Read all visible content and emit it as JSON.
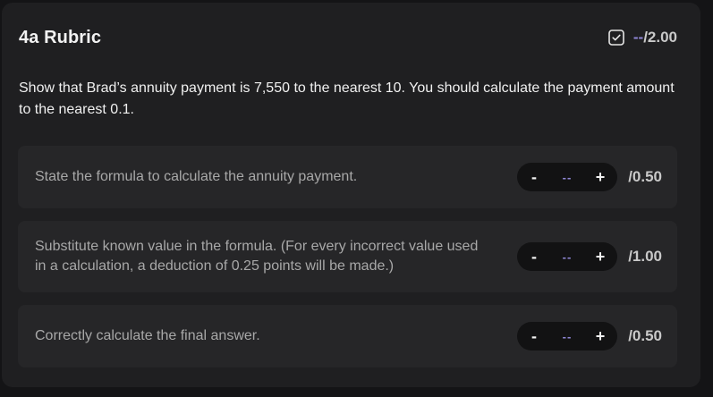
{
  "rubric": {
    "title": "4a Rubric",
    "total_score": "--",
    "total_max": "/2.00",
    "question": "Show that Brad’s annuity payment is 7,550 to the nearest 10. You should calculate the payment amount to the nearest 0.1."
  },
  "criteria": [
    {
      "text": "State the formula to calculate the annuity payment.",
      "decrement_label": "-",
      "score": "--",
      "increment_label": "+",
      "max": "/0.50"
    },
    {
      "text": "Substitute known value in the formula. (For every incorrect value used in a calculation, a deduction of 0.25 points will be made.)",
      "decrement_label": "-",
      "score": "--",
      "increment_label": "+",
      "max": "/1.00"
    },
    {
      "text": "Correctly calculate the final answer.",
      "decrement_label": "-",
      "score": "--",
      "increment_label": "+",
      "max": "/0.50"
    }
  ],
  "colors": {
    "accent": "#8f86d6",
    "panel": "#1f1f21",
    "card": "#262628"
  },
  "icons": {
    "total": "checkbox-check-icon"
  }
}
